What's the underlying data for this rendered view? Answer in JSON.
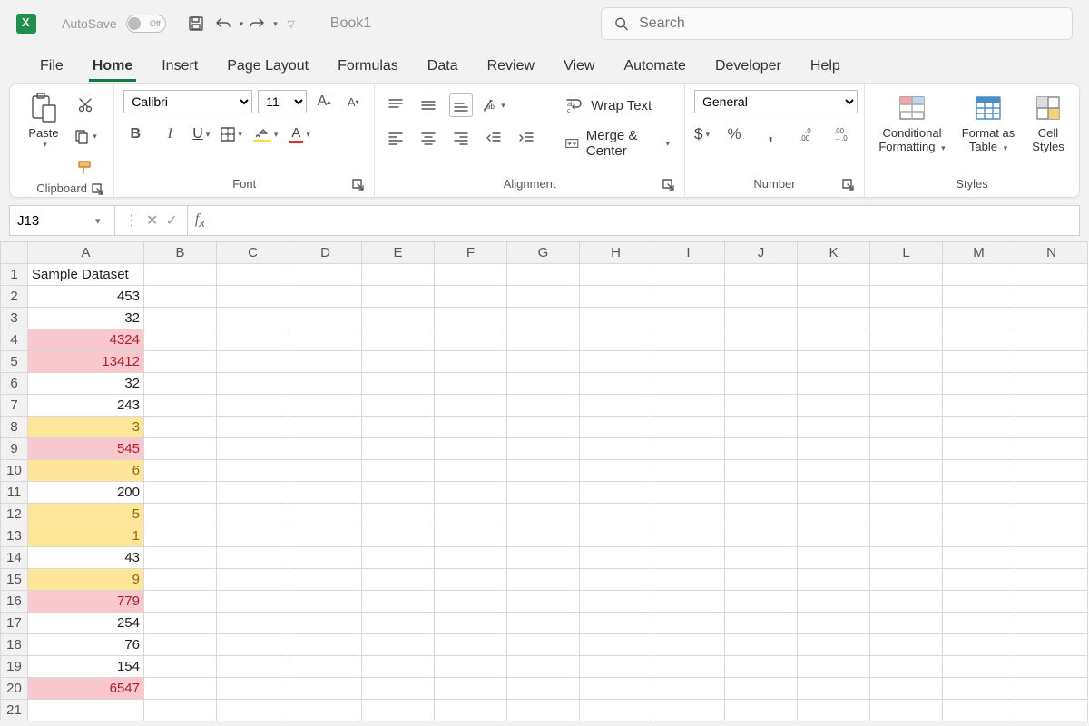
{
  "titlebar": {
    "autosave": "AutoSave",
    "toggle": "Off",
    "doc": "Book1",
    "search_placeholder": "Search"
  },
  "tabs": [
    "File",
    "Home",
    "Insert",
    "Page Layout",
    "Formulas",
    "Data",
    "Review",
    "View",
    "Automate",
    "Developer",
    "Help"
  ],
  "active_tab": "Home",
  "ribbon": {
    "clipboard": {
      "paste": "Paste",
      "label": "Clipboard"
    },
    "font": {
      "name": "Calibri",
      "size": "11",
      "label": "Font",
      "bold": "B",
      "italic": "I",
      "underline": "U",
      "fill": "A",
      "color": "A"
    },
    "alignment": {
      "label": "Alignment",
      "wrap": "Wrap Text",
      "merge": "Merge & Center"
    },
    "number": {
      "format": "General",
      "label": "Number",
      "currency": "$",
      "percent": "%",
      "comma": ","
    },
    "styles": {
      "cond": "Conditional",
      "cond2": "Formatting",
      "fmt": "Format as",
      "fmt2": "Table",
      "cell": "Cell",
      "cell2": "Styles",
      "label": "Styles"
    }
  },
  "fx": {
    "name": "J13",
    "value": ""
  },
  "columns": [
    "A",
    "B",
    "C",
    "D",
    "E",
    "F",
    "G",
    "H",
    "I",
    "J",
    "K",
    "L",
    "M",
    "N"
  ],
  "rows": [
    {
      "n": 1,
      "a": "Sample Dataset",
      "align": "left"
    },
    {
      "n": 2,
      "a": "453"
    },
    {
      "n": 3,
      "a": "32"
    },
    {
      "n": 4,
      "a": "4324",
      "hl": "pink"
    },
    {
      "n": 5,
      "a": "13412",
      "hl": "pink"
    },
    {
      "n": 6,
      "a": "32"
    },
    {
      "n": 7,
      "a": "243"
    },
    {
      "n": 8,
      "a": "3",
      "hl": "yellow"
    },
    {
      "n": 9,
      "a": "545",
      "hl": "pink"
    },
    {
      "n": 10,
      "a": "6",
      "hl": "yellow"
    },
    {
      "n": 11,
      "a": "200"
    },
    {
      "n": 12,
      "a": "5",
      "hl": "yellow"
    },
    {
      "n": 13,
      "a": "1",
      "hl": "yellow"
    },
    {
      "n": 14,
      "a": "43"
    },
    {
      "n": 15,
      "a": "9",
      "hl": "yellow"
    },
    {
      "n": 16,
      "a": "779",
      "hl": "pink"
    },
    {
      "n": 17,
      "a": "254"
    },
    {
      "n": 18,
      "a": "76"
    },
    {
      "n": 19,
      "a": "154"
    },
    {
      "n": 20,
      "a": "6547",
      "hl": "pink"
    },
    {
      "n": 21,
      "a": ""
    }
  ]
}
